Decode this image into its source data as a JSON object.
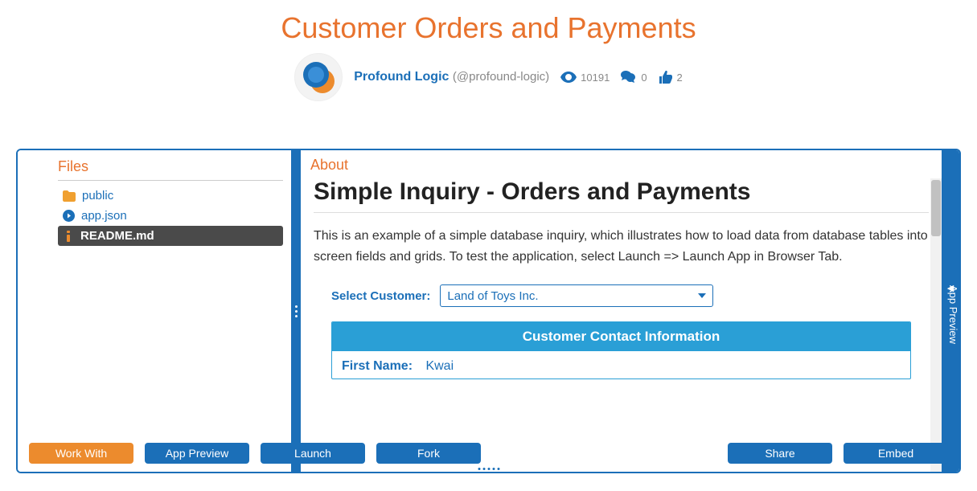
{
  "title": "Customer Orders and Payments",
  "author": {
    "name": "Profound Logic",
    "handle": "(@profound-logic)"
  },
  "stats": {
    "views": "10191",
    "comments": "0",
    "likes": "2"
  },
  "files": {
    "heading": "Files",
    "items": [
      {
        "label": "public"
      },
      {
        "label": "app.json"
      },
      {
        "label": "README.md"
      }
    ]
  },
  "about": {
    "heading": "About",
    "title": "Simple Inquiry - Orders and Payments",
    "body": "This is an example of a simple database inquiry, which illustrates how to load data from database tables into screen fields and grids. To test the application, select Launch => Launch App in Browser Tab."
  },
  "form": {
    "select_label": "Select Customer:",
    "select_value": "Land of Toys Inc.",
    "contact_heading": "Customer Contact Information",
    "first_name_label": "First Name:",
    "first_name_value": "Kwai"
  },
  "right_tab": "App Preview",
  "buttons": {
    "work_with": "Work With",
    "app_preview": "App Preview",
    "launch": "Launch",
    "fork": "Fork",
    "share": "Share",
    "embed": "Embed"
  }
}
